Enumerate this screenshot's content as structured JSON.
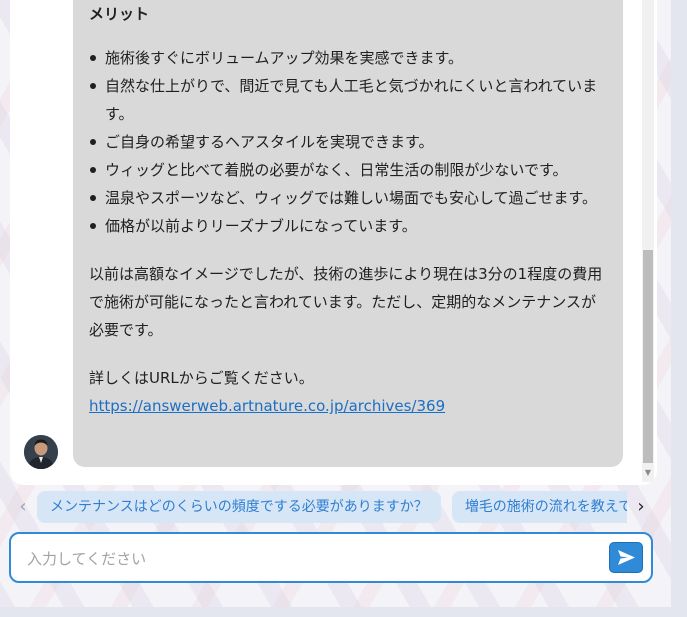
{
  "message": {
    "heading": "メリット",
    "bullets": [
      "施術後すぐにボリュームアップ効果を実感できます。",
      "自然な仕上がりで、間近で見ても人工毛と気づかれにくいと言われています。",
      "ご自身の希望するヘアスタイルを実現できます。",
      "ウィッグと比べて着脱の必要がなく、日常生活の制限が少ないです。",
      "温泉やスポーツなど、ウィッグでは難しい場面でも安心して過ごせます。",
      "価格が以前よりリーズナブルになっています。"
    ],
    "paragraph": "以前は高額なイメージでしたが、技術の進歩により現在は3分の1程度の費用で施術が可能になったと言われています。ただし、定期的なメンテナンスが必要です。",
    "url_intro": "詳しくはURLからご覧ください。",
    "url": "https://answerweb.artnature.co.jp/archives/369"
  },
  "suggestions": [
    "メンテナンスはどのくらいの頻度でする必要がありますか？",
    "増毛の施術の流れを教えて"
  ],
  "nav": {
    "prev": "‹",
    "next": "›"
  },
  "input": {
    "placeholder": "入力してください",
    "value": ""
  },
  "icons": {
    "avatar": "assistant-avatar",
    "send": "send-icon",
    "prev": "chevron-left-icon",
    "next": "chevron-right-icon",
    "scroll_down": "scroll-down-arrow-icon"
  },
  "colors": {
    "accent": "#2f8bd8",
    "bubble": "#d9d9d9",
    "chip_bg": "#d7e6f6",
    "chip_text": "#2f7fd0",
    "link": "#1b6fc4"
  }
}
